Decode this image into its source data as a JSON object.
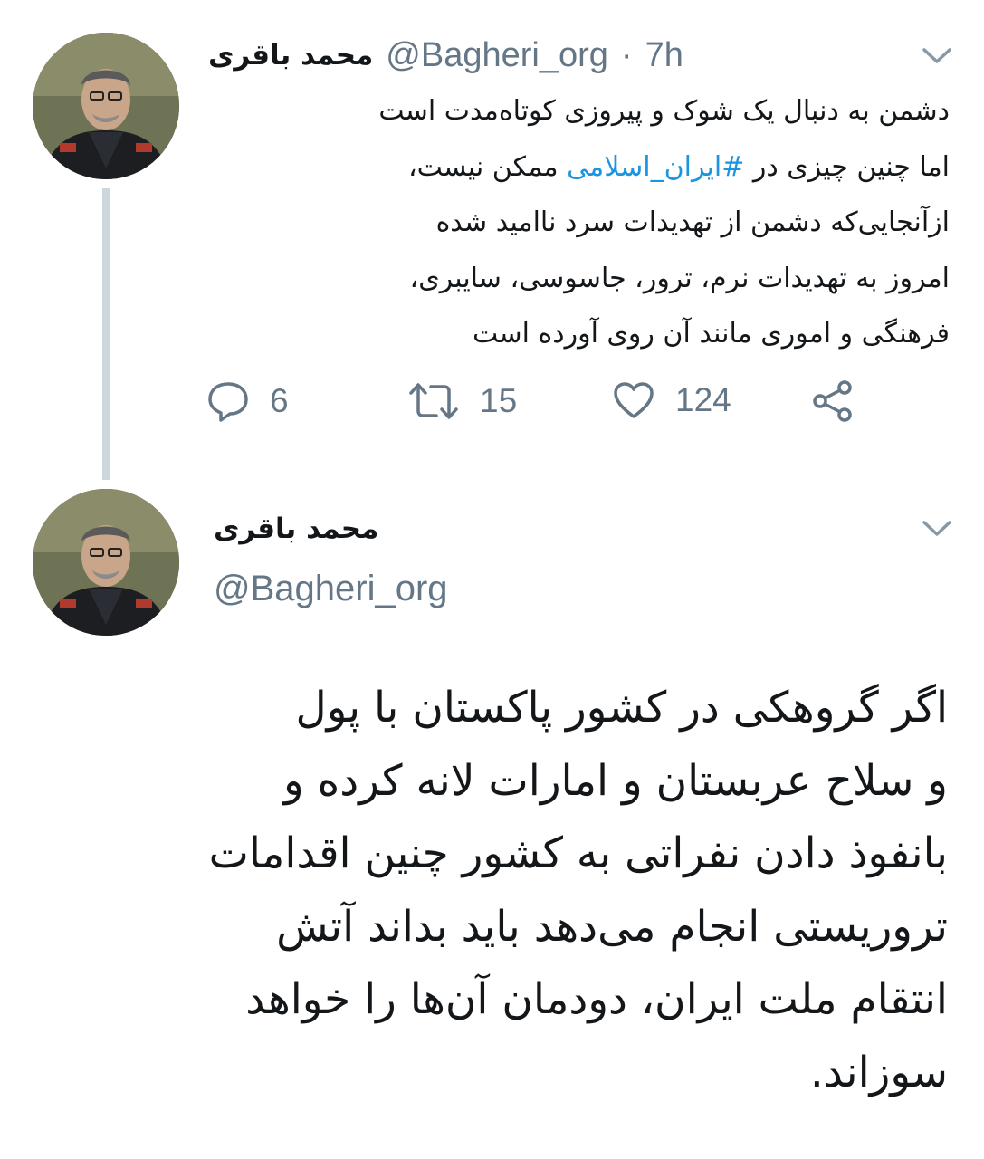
{
  "tweet1": {
    "display_name": "محمد باقری",
    "handle": "@Bagheri_org",
    "separator": "·",
    "time": "7h",
    "avatar_icon": "profile-photo-uniformed-man",
    "text_lines": [
      {
        "before": "دشمن به دنبال یک شوک و پیروزی کوتاه‌مدت است",
        "hashtag": "",
        "after": ""
      },
      {
        "before": "اما چنین چیزی در ",
        "hashtag": "#ایران_اسلامی",
        "after": " ممکن نیست،"
      },
      {
        "before": "ازآنجایی‌که دشمن از تهدیدات سرد ناامید شده",
        "hashtag": "",
        "after": ""
      },
      {
        "before": "امروز به تهدیدات نرم، ترور، جاسوسی، سایبری،",
        "hashtag": "",
        "after": ""
      },
      {
        "before": "فرهنگی و اموری مانند آن روی آورده است",
        "hashtag": "",
        "after": ""
      }
    ],
    "actions": {
      "reply": {
        "icon": "reply-icon",
        "count": "6"
      },
      "retweet": {
        "icon": "retweet-icon",
        "count": "15"
      },
      "like": {
        "icon": "heart-icon",
        "count": "124"
      },
      "share": {
        "icon": "share-icon"
      }
    }
  },
  "tweet2": {
    "display_name": "محمد باقری",
    "handle": "@Bagheri_org",
    "avatar_icon": "profile-photo-uniformed-man",
    "text_lines": [
      "اگر گروهکی در کشور پاکستان با پول",
      "و سلاح عربستان و امارات لانه کرده و",
      "بانفوذ دادن نفراتی به کشور چنین اقدامات",
      "تروریستی انجام می‌دهد باید بداند آتش",
      "انتقام ملت ایران، دودمان آن‌ها را خواهد",
      "سوزاند."
    ]
  },
  "colors": {
    "text": "#14171a",
    "secondary": "#657786",
    "link": "#1b95e0",
    "thread_line": "#ccd6dd",
    "background": "#ffffff"
  }
}
